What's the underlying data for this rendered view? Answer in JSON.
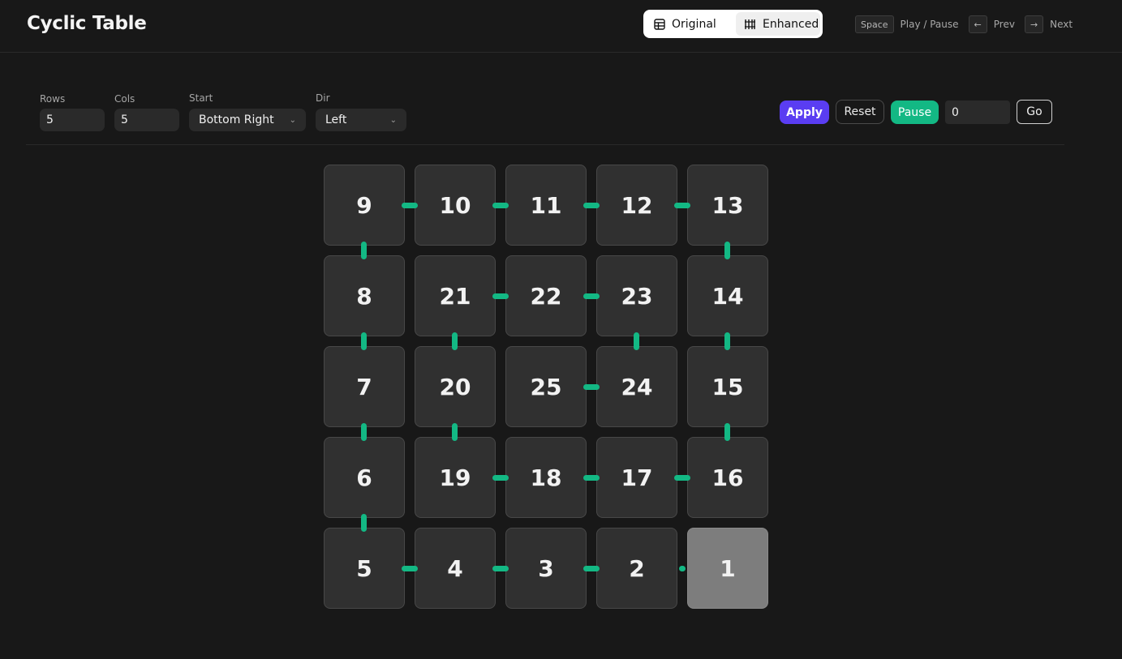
{
  "header": {
    "title": "Cyclic Table",
    "view_toggle": {
      "original_label": "Original",
      "enhanced_label": "Enhanced",
      "active": "Enhanced"
    },
    "shortcuts": [
      {
        "key": "Space",
        "label": "Play / Pause"
      },
      {
        "key": "←",
        "label": "Prev"
      },
      {
        "key": "→",
        "label": "Next"
      }
    ]
  },
  "controls": {
    "rows": {
      "label": "Rows",
      "value": "5"
    },
    "cols": {
      "label": "Cols",
      "value": "5"
    },
    "start": {
      "label": "Start",
      "value": "Bottom Right"
    },
    "dir": {
      "label": "Dir",
      "value": "Left"
    },
    "apply_label": "Apply",
    "reset_label": "Reset",
    "pause_label": "Pause",
    "step_value": "0",
    "go_label": "Go"
  },
  "colors": {
    "accent": "#5a3df2",
    "connector": "#13b884",
    "active_cell": "#7d7d7d"
  },
  "table": {
    "rows": 5,
    "cols": 5,
    "active_value": "1",
    "cells": [
      [
        "9",
        "10",
        "11",
        "12",
        "13"
      ],
      [
        "8",
        "21",
        "22",
        "23",
        "14"
      ],
      [
        "7",
        "20",
        "25",
        "24",
        "15"
      ],
      [
        "6",
        "19",
        "18",
        "17",
        "16"
      ],
      [
        "5",
        "4",
        "3",
        "2",
        "1"
      ]
    ]
  }
}
